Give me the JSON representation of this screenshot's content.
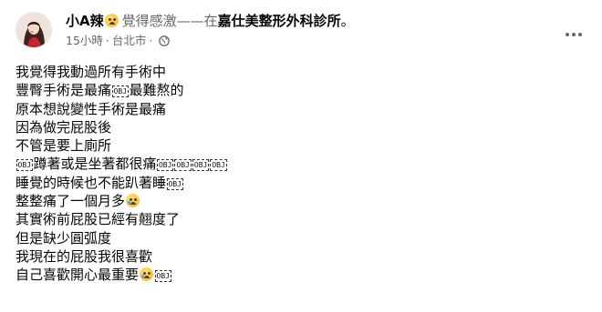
{
  "header": {
    "author": "小A辣",
    "feeling_text": "覺得感激——在",
    "place": "嘉仕美整形外科診所",
    "place_suffix": "。",
    "timestamp": "15小時",
    "separator": "·",
    "location": "台北市",
    "dot_after_location": "·",
    "privacy_icon": "globe-icon",
    "more_icon": "more-horizontal-icon"
  },
  "placeholder_glyph": "OBJ",
  "post_lines": [
    "我覺得我動過所有手術中",
    "豐臀手術是最痛",
    "最難熬的",
    "原本想說變性手術是最痛",
    "因為做完屁股後",
    "不管是要上廁所",
    "蹲著或是坐著都很痛",
    "睡覺的時候也不能趴著睡",
    "整整痛了一個月多",
    "其實術前屁股已經有翹度了",
    "但是缺少圓弧度",
    "我現在的屁股我很喜歡",
    "自己喜歡開心最重要"
  ],
  "colors": {
    "text_primary": "#050505",
    "text_secondary": "#65676b",
    "background": "#ffffff"
  }
}
